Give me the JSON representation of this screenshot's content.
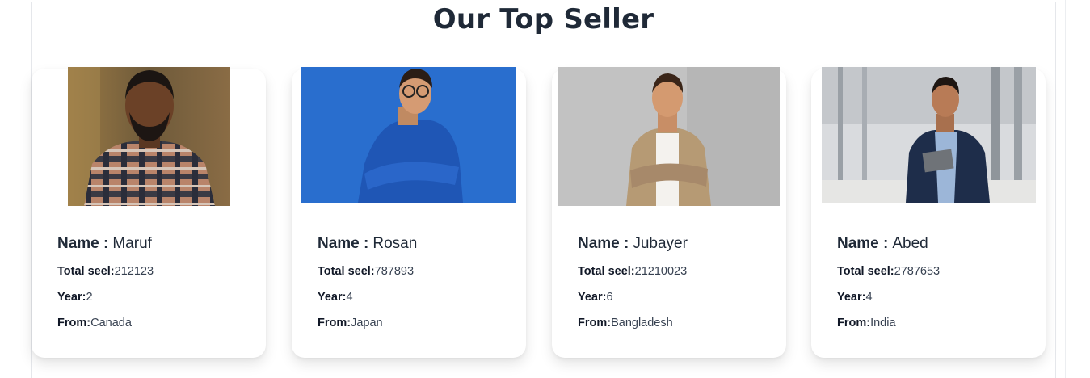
{
  "page": {
    "title": "Our Top Seller"
  },
  "labels": {
    "name": "Name :",
    "total": "Total seel:",
    "year": "Year:",
    "from": "From:"
  },
  "sellers": [
    {
      "name": "Maruf",
      "total": "212123",
      "year": "2",
      "from": "Canada"
    },
    {
      "name": "Rosan",
      "total": "787893",
      "year": "4",
      "from": "Japan"
    },
    {
      "name": "Jubayer",
      "total": "21210023",
      "year": "6",
      "from": "Bangladesh"
    },
    {
      "name": "Abed",
      "total": "2787653",
      "year": "4",
      "from": "India"
    }
  ],
  "colors": {
    "heading": "#1f2937",
    "card_bg": "#ffffff",
    "photo2_bg": "#2e74d6",
    "photo3_bg": "#c4c4c4"
  }
}
